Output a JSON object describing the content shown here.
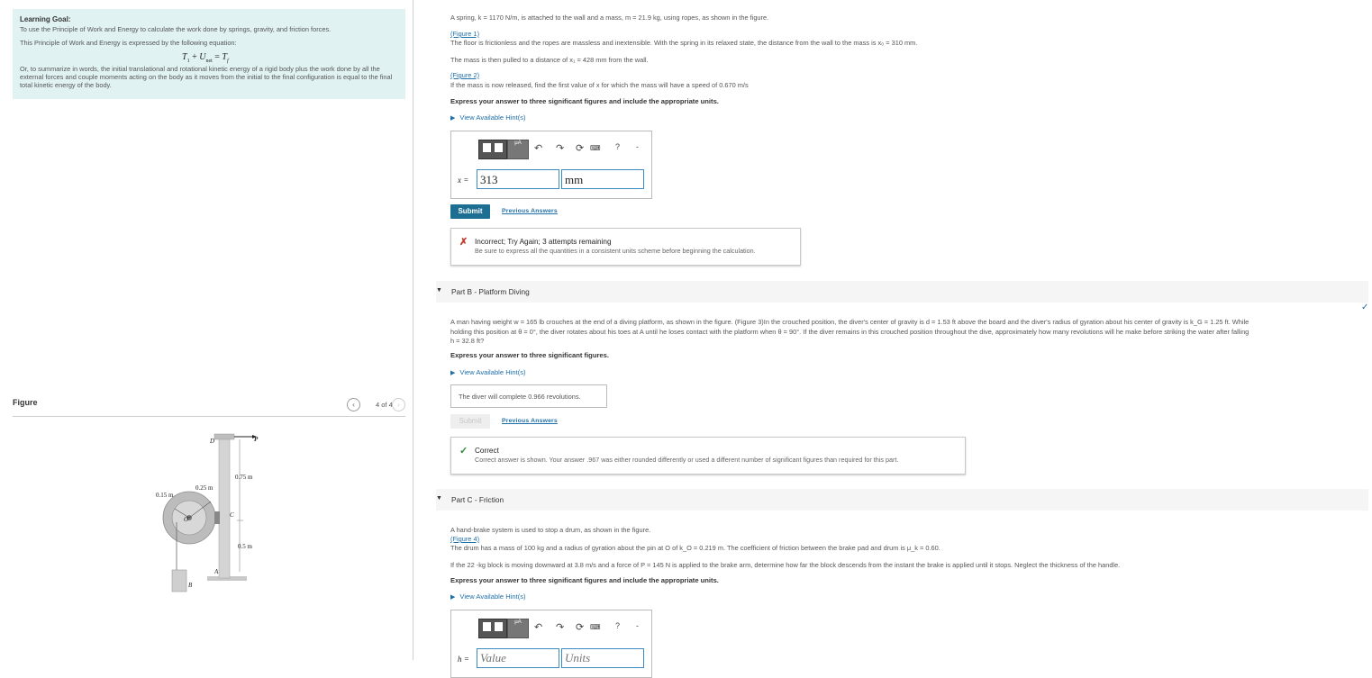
{
  "learning_goal": {
    "title": "Learning Goal:",
    "line1": "To use the Principle of Work and Energy to calculate the work done by springs, gravity, and friction forces.",
    "line2": "This Principle of Work and Energy is expressed by the following equation:",
    "equation": "T₁ + U_net = T_f",
    "summary": "Or, to summarize in words, the initial translational and rotational kinetic energy of a rigid body plus the work done by all the external forces and couple moments acting on the body as it moves from the initial to the final configuration is equal to the final total kinetic energy of the body."
  },
  "figure": {
    "label": "Figure",
    "count": "4 of 4",
    "labels": {
      "D": "D",
      "P": "P",
      "len1": "0.75 m",
      "r_outer": "0.25 m",
      "r_inner": "0.15 m",
      "O": "O",
      "C": "C",
      "len2": "0.5 m",
      "A": "A",
      "B": "B"
    }
  },
  "partA": {
    "text1": "A spring, k = 1170 N/m, is attached to the wall and a mass, m = 21.9 kg, using ropes, as shown in the figure.",
    "fig_link1": "(Figure 1)",
    "text2": "The floor is frictionless and the ropes are massless and inextensible. With the spring in its relaxed state, the distance from the wall to the mass is x₀ = 310 mm.",
    "text3": "The mass is then pulled to a distance of x₁ = 428 mm from the wall.",
    "fig_link2": "(Figure 2)",
    "text4": "If the mass is now released, find the first value of x for which the mass will have a speed of 0.670 m/s",
    "instruction": "Express your answer to three significant figures and include the appropriate units.",
    "hint": "View Available Hint(s)",
    "var_label": "x =",
    "value": "313",
    "units": "mm",
    "submit": "Submit",
    "previous": "Previous Answers",
    "feedback_title": "Incorrect; Try Again; 3 attempts remaining",
    "feedback_text": "Be sure to express all the quantities in a consistent units scheme before beginning the calculation."
  },
  "partB": {
    "header": "Part B - Platform Diving",
    "text1": "A man having weight w = 165 lb crouches at the end of a diving platform, as shown in the figure. (Figure 3)In the crouched position, the diver's center of gravity is d = 1.53 ft above the board and the diver's radius of gyration about his center of gravity is k_G = 1.25 ft. While",
    "text2": "holding this position at θ = 0°, the diver rotates about his toes at A until he loses contact with the platform when θ = 90°. If the diver remains in this crouched position throughout the dive, approximately how many revolutions will he make before striking the water after falling",
    "text3": "h = 32.8 ft?",
    "instruction": "Express your answer to three significant figures.",
    "hint": "View Available Hint(s)",
    "answer": "The diver will complete  0.966  revolutions.",
    "submit": "Submit",
    "previous": "Previous Answers",
    "feedback_title": "Correct",
    "feedback_text": "Correct answer is shown. Your answer .967 was either rounded differently or used a different number of significant figures than required for this part."
  },
  "partC": {
    "header": "Part C - Friction",
    "text1": "A hand-brake system is used to stop a drum, as shown in the figure.",
    "fig_link": "(Figure 4)",
    "text2": "The drum has a mass of 100 kg and a radius of gyration about the pin at O of k_O = 0.219 m. The coefficient of friction between the brake pad and drum is μ_k = 0.60.",
    "text3": "If the 22 -kg block is moving downward at 3.8 m/s and a force of P = 145 N is applied to the brake arm, determine how far the block descends from the instant the brake is applied until it stops. Neglect the thickness of the handle.",
    "instruction": "Express your answer to three significant figures and include the appropriate units.",
    "hint": "View Available Hint(s)",
    "var_label": "h =",
    "value_placeholder": "Value",
    "units_placeholder": "Units"
  },
  "colors": {
    "accent": "#1d6e93",
    "goal_bg": "#e1f2f3",
    "link": "#1f6fa8",
    "incorrect": "#c0392b",
    "correct": "#2e8b3a"
  }
}
